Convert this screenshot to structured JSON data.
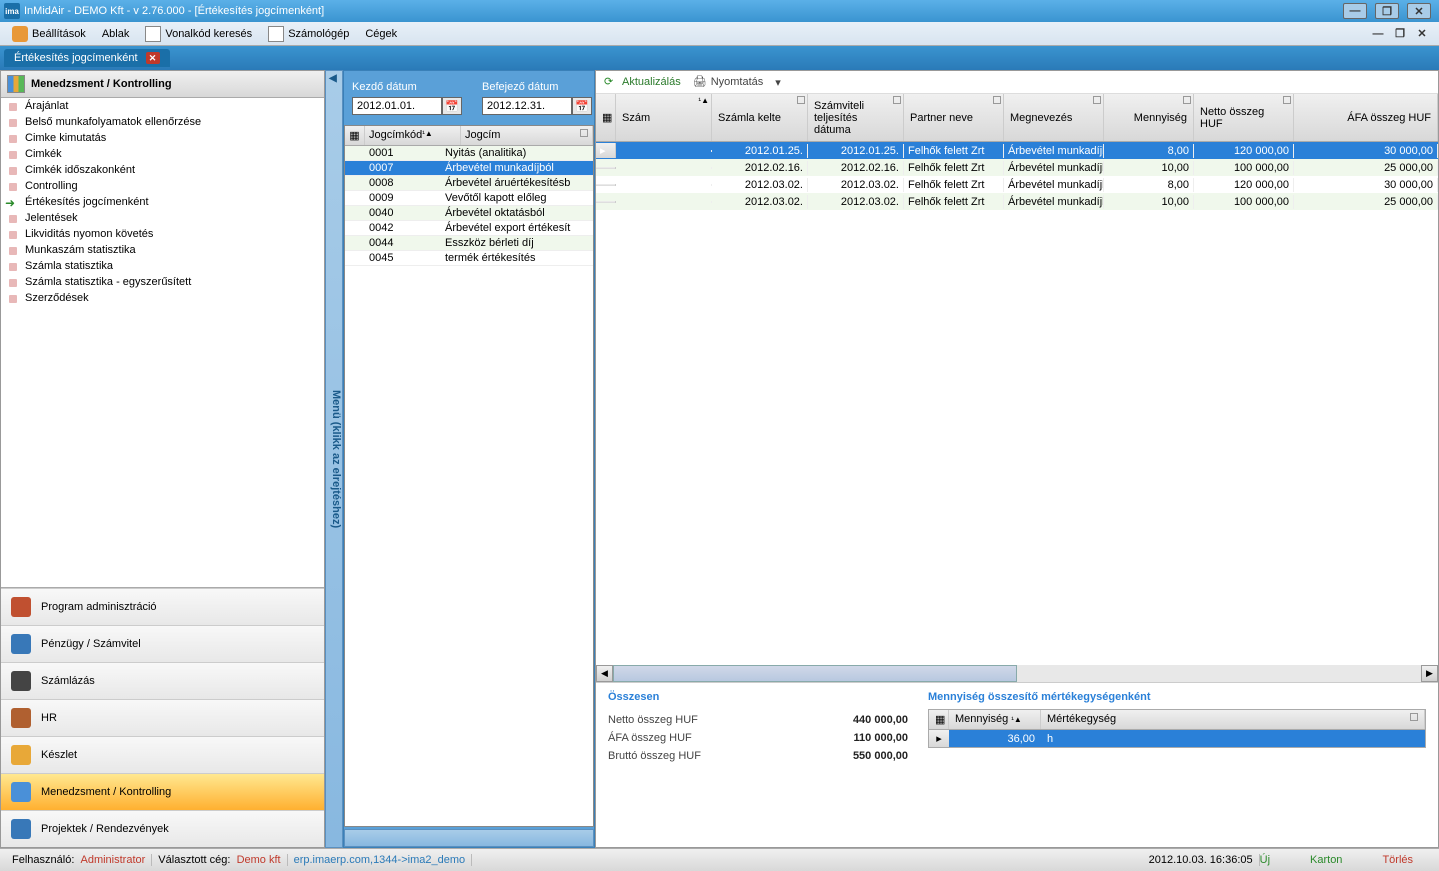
{
  "window": {
    "app_abbr": "ima",
    "title": "InMidAir - DEMO Kft - v 2.76.000 - [Értékesítés jogcímenként]"
  },
  "menubar": {
    "items": [
      "Beállítások",
      "Ablak",
      "Vonalkód keresés",
      "Számológép",
      "Cégek"
    ]
  },
  "tab": {
    "label": "Értékesítés jogcímenként"
  },
  "left_panel": {
    "header": "Menedzsment / Kontrolling",
    "tree": [
      {
        "label": "Árajánlat"
      },
      {
        "label": "Belső munkafolyamatok ellenőrzése"
      },
      {
        "label": "Cimke kimutatás"
      },
      {
        "label": "Cimkék"
      },
      {
        "label": "Cimkék időszakonként"
      },
      {
        "label": "Controlling"
      },
      {
        "label": "Értékesítés jogcímenként",
        "active": true
      },
      {
        "label": "Jelentések"
      },
      {
        "label": "Likviditás nyomon követés"
      },
      {
        "label": "Munkaszám statisztika"
      },
      {
        "label": "Számla statisztika"
      },
      {
        "label": "Számla statisztika - egyszerűsített"
      },
      {
        "label": "Szerződések"
      }
    ],
    "nav": [
      {
        "label": "Program adminisztráció",
        "icon": "home-icon",
        "color": "#c05030"
      },
      {
        "label": "Pénzügy / Számvitel",
        "icon": "calculator-icon",
        "color": "#3878b8"
      },
      {
        "label": "Számlázás",
        "icon": "pencil-icon",
        "color": "#444"
      },
      {
        "label": "HR",
        "icon": "people-icon",
        "color": "#b06030"
      },
      {
        "label": "Készlet",
        "icon": "box-icon",
        "color": "#e8a838"
      },
      {
        "label": "Menedzsment / Kontrolling",
        "icon": "chart-icon",
        "color": "#4a90d8",
        "selected": true
      },
      {
        "label": "Projektek / Rendezvények",
        "icon": "tag-icon",
        "color": "#3878b8"
      }
    ]
  },
  "collapse_label": "Menü (klikk az elrejtéshez)",
  "mid_panel": {
    "start_label": "Kezdő dátum",
    "end_label": "Befejező dátum",
    "start_date": "2012.01.01.",
    "end_date": "2012.12.31.",
    "headers": {
      "code": "Jogcímkód",
      "name": "Jogcím"
    },
    "rows": [
      {
        "code": "0001",
        "name": "Nyitás (analitika)"
      },
      {
        "code": "0007",
        "name": "Árbevétel munkadíjból",
        "selected": true
      },
      {
        "code": "0008",
        "name": "Árbevétel áruértékesítésb"
      },
      {
        "code": "0009",
        "name": "Vevőtől kapott előleg"
      },
      {
        "code": "0040",
        "name": "Árbevétel oktatásból"
      },
      {
        "code": "0042",
        "name": "Árbevétel export értékesít"
      },
      {
        "code": "0044",
        "name": "Esszköz bérleti díj"
      },
      {
        "code": "0045",
        "name": "termék értékesítés"
      }
    ]
  },
  "right_panel": {
    "toolbar": {
      "refresh": "Aktualizálás",
      "print": "Nyomtatás"
    },
    "headers": [
      "Szám",
      "Számla kelte",
      "Számviteli teljesítés dátuma",
      "Partner neve",
      "Megnevezés",
      "Mennyiség",
      "Netto összeg HUF",
      "ÁFA összeg HUF"
    ],
    "rows": [
      {
        "d1": "2012.01.25.",
        "d2": "2012.01.25.",
        "partner": "Felhők felett Zrt",
        "desc": "Árbevétel munkadíjb",
        "qty": "8,00",
        "net": "120 000,00",
        "vat": "30 000,00",
        "selected": true
      },
      {
        "d1": "2012.02.16.",
        "d2": "2012.02.16.",
        "partner": "Felhők felett Zrt",
        "desc": "Árbevétel munkadíjb",
        "qty": "10,00",
        "net": "100 000,00",
        "vat": "25 000,00"
      },
      {
        "d1": "2012.03.02.",
        "d2": "2012.03.02.",
        "partner": "Felhők felett Zrt",
        "desc": "Árbevétel munkadíjb",
        "qty": "8,00",
        "net": "120 000,00",
        "vat": "30 000,00"
      },
      {
        "d1": "2012.03.02.",
        "d2": "2012.03.02.",
        "partner": "Felhők felett Zrt",
        "desc": "Árbevétel munkadíjb",
        "qty": "10,00",
        "net": "100 000,00",
        "vat": "25 000,00"
      }
    ],
    "totals": {
      "title": "Összesen",
      "rows": [
        {
          "label": "Netto összeg HUF",
          "value": "440 000,00"
        },
        {
          "label": "ÁFA összeg HUF",
          "value": "110 000,00"
        },
        {
          "label": "Bruttó összeg HUF",
          "value": "550 000,00"
        }
      ]
    },
    "qty_panel": {
      "title": "Mennyiség összesítő mértékegységenként",
      "headers": {
        "qty": "Mennyiség",
        "unit": "Mértékegység"
      },
      "row": {
        "qty": "36,00",
        "unit": "h"
      }
    }
  },
  "status": {
    "user_label": "Felhasználó:",
    "user": "Administrator",
    "company_label": "Választott cég:",
    "company": "Demo kft",
    "url": "erp.imaerp.com,1344->ima2_demo",
    "datetime": "2012.10.03. 16:36:05",
    "links": {
      "new": "Új",
      "card": "Karton",
      "delete": "Törlés"
    }
  }
}
